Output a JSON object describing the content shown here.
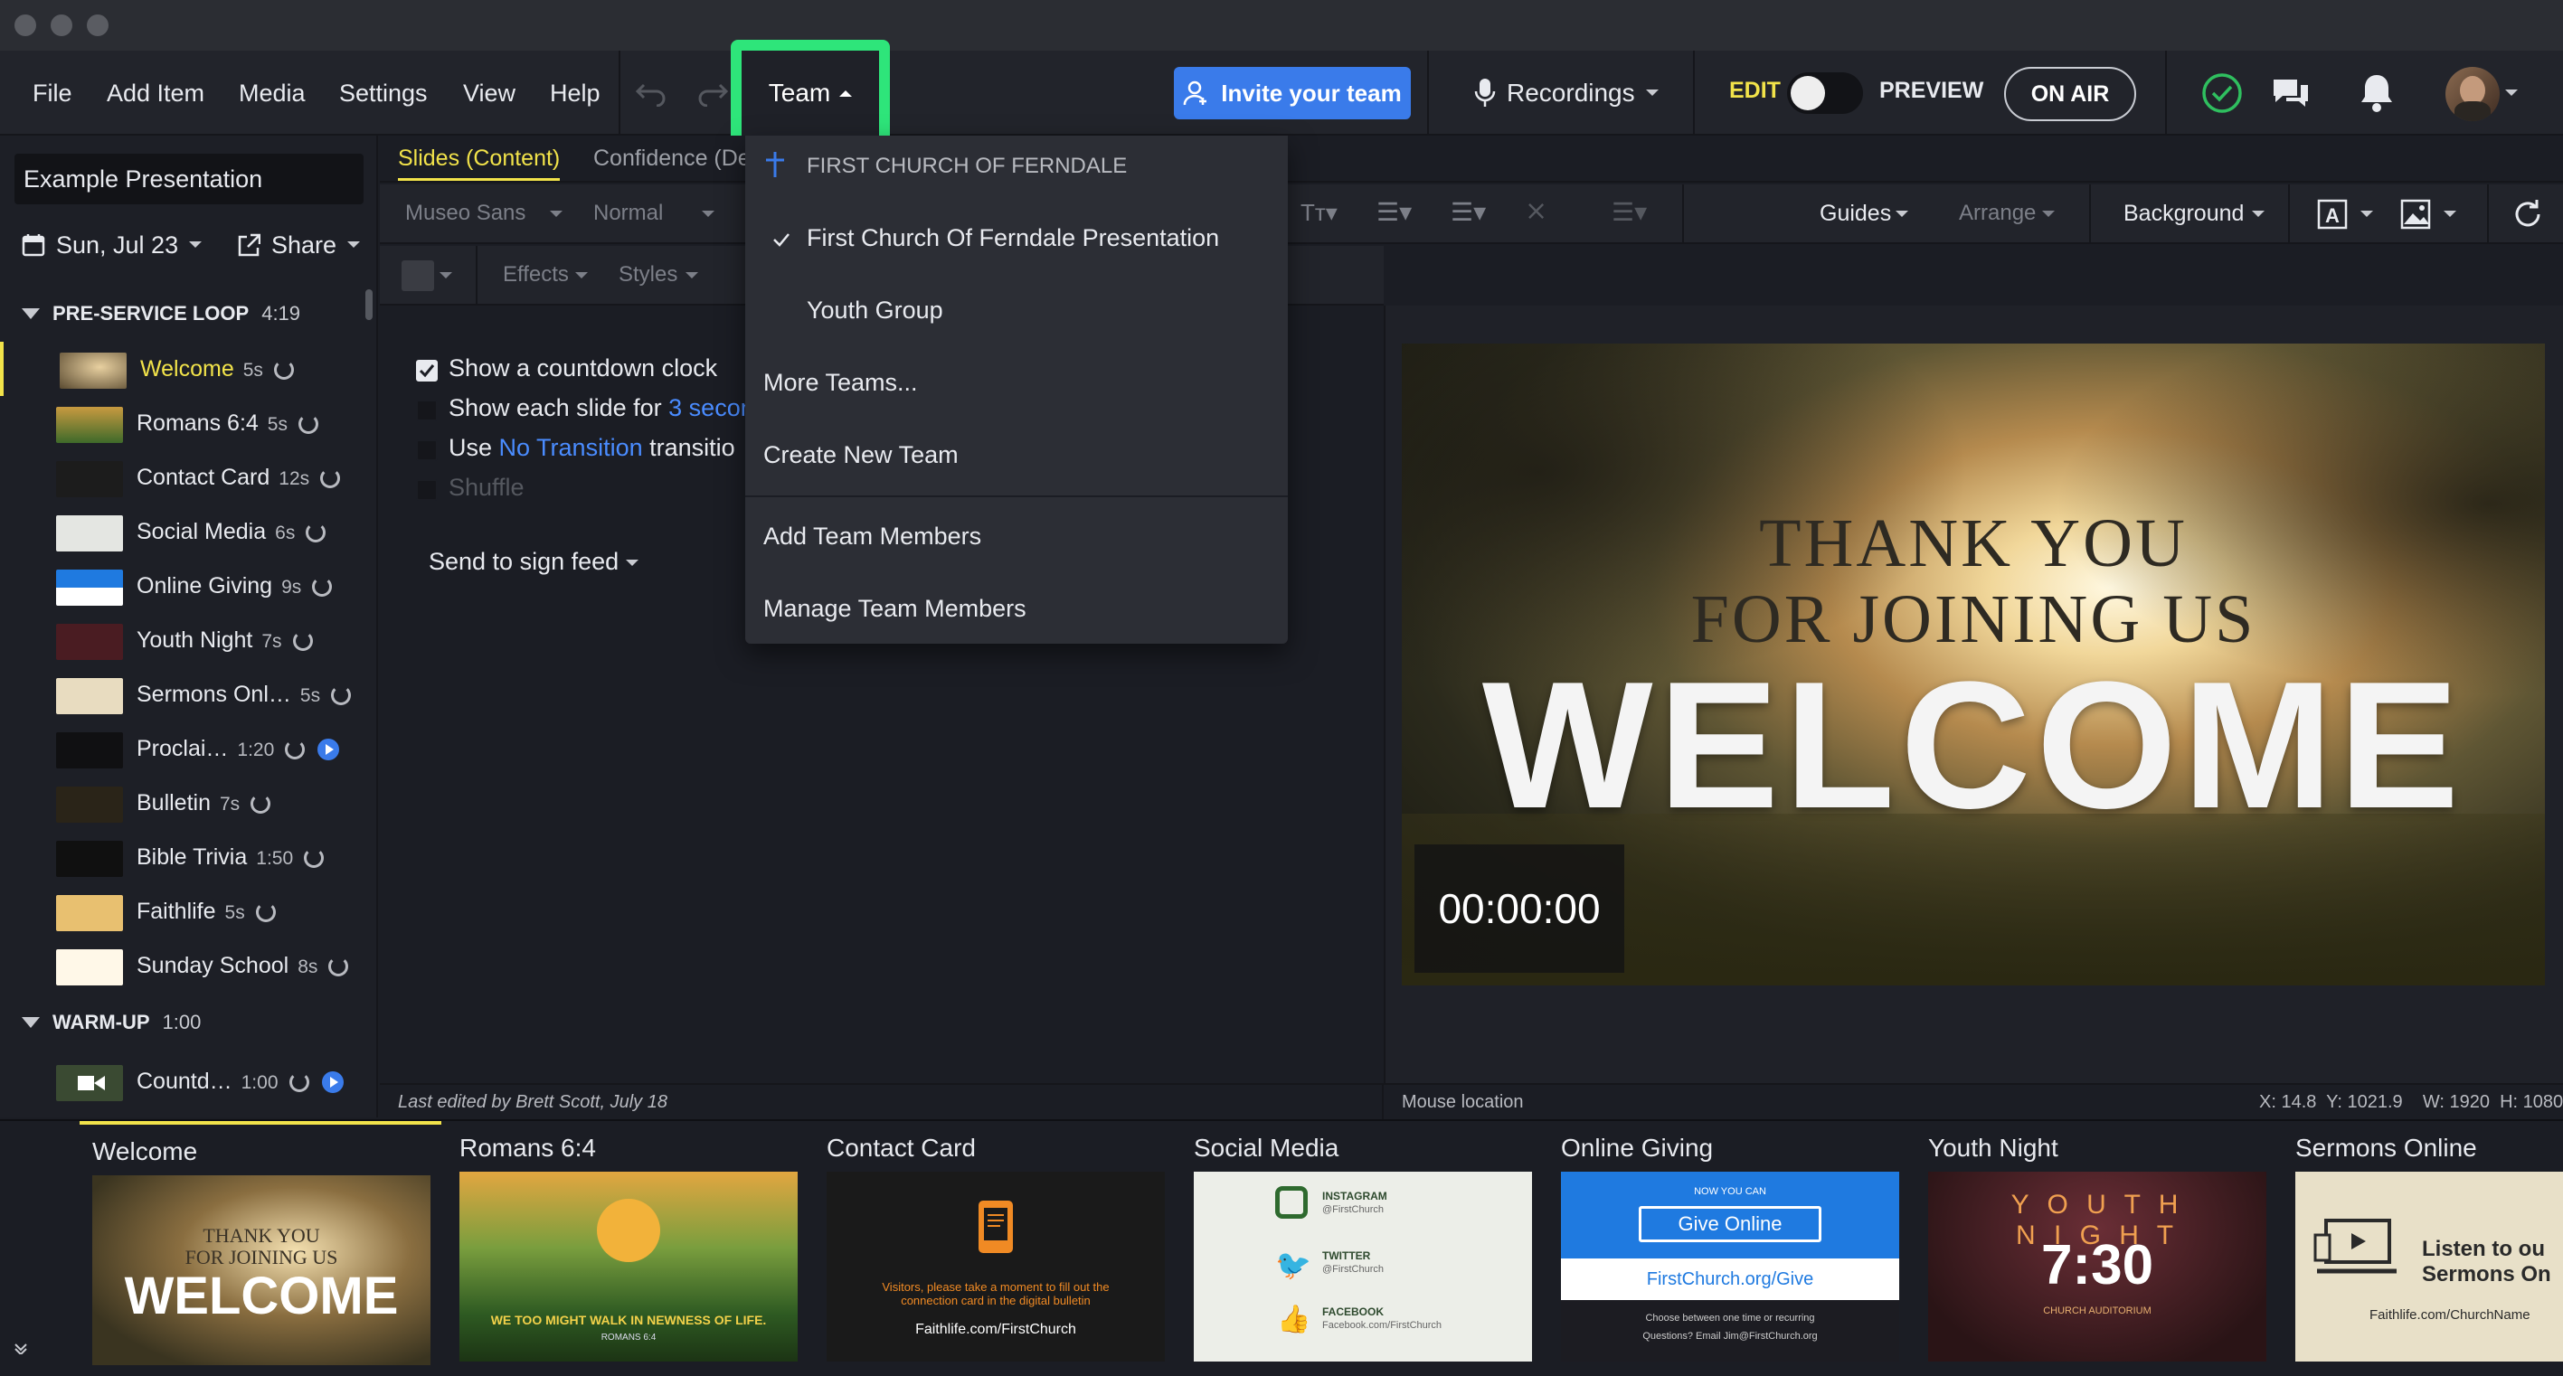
{
  "menubar": {
    "items": [
      "File",
      "Add Item",
      "Media",
      "Settings",
      "View",
      "Help"
    ],
    "team_label": "Team",
    "invite_label": "Invite your team",
    "recordings_label": "Recordings",
    "edit_label": "EDIT",
    "preview_label": "PREVIEW",
    "onair_label": "ON AIR"
  },
  "left": {
    "presentation_title": "Example Presentation",
    "date": "Sun, Jul 23",
    "share": "Share",
    "sections": [
      {
        "name": "PRE-SERVICE LOOP",
        "duration": "4:19",
        "slides": [
          {
            "name": "Welcome",
            "dur": "5s"
          },
          {
            "name": "Romans 6:4",
            "dur": "5s"
          },
          {
            "name": "Contact Card",
            "dur": "12s"
          },
          {
            "name": "Social Media",
            "dur": "6s"
          },
          {
            "name": "Online Giving",
            "dur": "9s"
          },
          {
            "name": "Youth Night",
            "dur": "7s"
          },
          {
            "name": "Sermons Onl…",
            "dur": "5s"
          },
          {
            "name": "Proclai…",
            "dur": "1:20"
          },
          {
            "name": "Bulletin",
            "dur": "7s"
          },
          {
            "name": "Bible Trivia",
            "dur": "1:50"
          },
          {
            "name": "Faithlife",
            "dur": "5s"
          },
          {
            "name": "Sunday School",
            "dur": "8s"
          }
        ]
      },
      {
        "name": "WARM-UP",
        "duration": "1:00",
        "slides": [
          {
            "name": "Countd…",
            "dur": "1:00"
          }
        ]
      }
    ]
  },
  "tabs": {
    "slides": "Slides (Content)",
    "confidence": "Confidence (De"
  },
  "format": {
    "font": "Museo Sans",
    "weight": "Normal",
    "effects": "Effects",
    "styles": "Styles",
    "guides": "Guides",
    "arrange": "Arrange",
    "background": "Background"
  },
  "options": {
    "countdown": "Show a countdown clock",
    "each_slide_pre": "Show each slide for",
    "each_slide_val": "3 secon",
    "use_pre": "Use",
    "transition_val": "No Transition",
    "transition_post": "transitio",
    "shuffle": "Shuffle",
    "send": "Send to sign feed"
  },
  "dropdown": {
    "org": "FIRST CHURCH OF FERNDALE",
    "selected": "First Church Of Ferndale Presentation",
    "youth": "Youth Group",
    "more": "More Teams...",
    "create": "Create New Team",
    "add": "Add Team Members",
    "manage": "Manage Team Members"
  },
  "preview": {
    "line1": "THANK YOU",
    "line2": "FOR JOINING US",
    "welcome": "WELCOME",
    "countdown": "00:00:00"
  },
  "status": {
    "last_edited": "Last edited by Brett Scott, July 18",
    "mouse": "Mouse location",
    "coords": "X: 14.8  Y: 1021.9    W: 1920  H: 1080"
  },
  "film": [
    {
      "label": "Welcome",
      "t1": "THANK YOU",
      "t2": "FOR JOINING US",
      "t3": "WELCOME"
    },
    {
      "label": "Romans 6:4",
      "t1": "WE TOO MIGHT WALK IN NEWNESS OF LIFE.",
      "t2": "ROMANS 6:4"
    },
    {
      "label": "Contact Card",
      "t1": "Visitors, please take a moment to fill out the connection card in the digital bulletin",
      "t2": "Faithlife.com/FirstChurch"
    },
    {
      "label": "Social Media",
      "t1": "INSTAGRAM",
      "t1b": "@FirstChurch",
      "t2": "TWITTER",
      "t2b": "@FirstChurch",
      "t3": "FACEBOOK",
      "t3b": "Facebook.com/FirstChurch"
    },
    {
      "label": "Online Giving",
      "t0": "NOW YOU CAN",
      "t1": "Give Online",
      "t2": "FirstChurch.org/Give",
      "t3": "Choose between one time or recurring",
      "t4": "Questions? Email Jim@FirstChurch.org"
    },
    {
      "label": "Youth Night",
      "t1": "Y O U T H",
      "t2": "N I G H T",
      "t3": "7:30",
      "t4": "CHURCH AUDITORIUM"
    },
    {
      "label": "Sermons Online",
      "t1": "Listen to ou",
      "t2": "Sermons On",
      "t3": "Faithlife.com/ChurchName"
    }
  ],
  "colors": {
    "accent_yellow": "#f2e34a",
    "highlight_green": "#2ee57a",
    "blue": "#3a7bea"
  }
}
